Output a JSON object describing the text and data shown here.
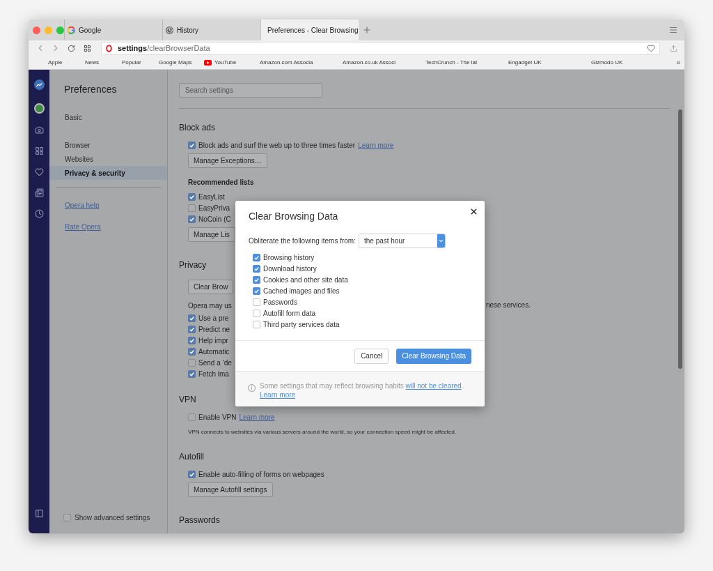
{
  "tabs": [
    {
      "title": "Google",
      "selected": false
    },
    {
      "title": "History",
      "selected": false
    },
    {
      "title": "Preferences - Clear Browsing",
      "selected": true
    }
  ],
  "address_bar": {
    "url": "**settings**/clearBrowserData"
  },
  "bookmarks": [
    {
      "label": "Apple",
      "kind": "plain"
    },
    {
      "label": "News",
      "kind": "plain"
    },
    {
      "label": "Popular",
      "kind": "plain"
    },
    {
      "label": "Google Maps",
      "kind": "plain"
    },
    {
      "label": "YouTube",
      "kind": "video"
    },
    {
      "label": "Amazon.com Associa",
      "kind": "plain"
    },
    {
      "label": "Amazon.co.uk Associ",
      "kind": "plain"
    },
    {
      "label": "TechCrunch - The lat",
      "kind": "plain"
    },
    {
      "label": "Engadget UK",
      "kind": "plain"
    },
    {
      "label": "Gizmodo UK",
      "kind": "plain"
    }
  ],
  "bookmarks_more": "»",
  "sidebar": {
    "title": "Preferences",
    "groups": [
      {
        "items": [
          {
            "label": "Basic",
            "selected": false
          }
        ]
      },
      {
        "items": [
          {
            "label": "Browser",
            "selected": false
          },
          {
            "label": "Websites",
            "selected": false
          },
          {
            "label": "Privacy & security",
            "selected": true
          }
        ]
      }
    ],
    "links": [
      "Opera help",
      "Rate Opera"
    ],
    "advanced": {
      "label": "Show advanced settings",
      "checked": false
    }
  },
  "search": {
    "placeholder": "Search settings"
  },
  "sections": [
    {
      "title": "Block ads",
      "blocks": [
        {
          "kind": "checkbox",
          "label": "Block ads and surf the web up to three times faster",
          "link": "Learn more",
          "checked": true
        },
        {
          "kind": "button",
          "label": "Manage Exceptions…"
        },
        {
          "kind": "subheading",
          "label": "Recommended lists"
        },
        {
          "kind": "checkbox",
          "label": "EasyList",
          "checked": true
        },
        {
          "kind": "checkbox",
          "label": "EasyPriva",
          "checked": false
        },
        {
          "kind": "checkbox",
          "label": "NoCoin (C",
          "checked": true
        },
        {
          "kind": "button",
          "label": "Manage Lis"
        }
      ]
    },
    {
      "title": "Privacy",
      "blocks": [
        {
          "kind": "button",
          "label": "Clear Brow"
        },
        {
          "kind": "split_note",
          "left": "Opera may us",
          "right": "nese services."
        },
        {
          "kind": "checkbox",
          "label": "Use a pre",
          "checked": true
        },
        {
          "kind": "checkbox",
          "label": "Predict ne",
          "checked": true
        },
        {
          "kind": "checkbox",
          "label": "Help impr",
          "checked": true
        },
        {
          "kind": "checkbox",
          "label": "Automatic",
          "checked": true
        },
        {
          "kind": "checkbox",
          "label": "Send a ‘de",
          "checked": false
        },
        {
          "kind": "checkbox",
          "label": "Fetch ima",
          "checked": true
        }
      ]
    },
    {
      "title": "VPN",
      "blocks": [
        {
          "kind": "checkbox",
          "label": "Enable VPN",
          "link": "Learn more",
          "checked": false
        },
        {
          "kind": "note",
          "label": "VPN connects to websites via various servers around the world, so your connection speed might be affected."
        }
      ]
    },
    {
      "title": "Autofill",
      "blocks": [
        {
          "kind": "checkbox",
          "label": "Enable auto-filling of forms on webpages",
          "checked": true
        },
        {
          "kind": "button",
          "label": "Manage Autofill settings"
        }
      ]
    },
    {
      "title": "Passwords"
    }
  ],
  "dialog": {
    "title": "Clear Browsing Data",
    "range_label": "Obliterate the following items from:",
    "range_value": "the past hour",
    "items": [
      {
        "label": "Browsing history",
        "checked": true
      },
      {
        "label": "Download history",
        "checked": true
      },
      {
        "label": "Cookies and other site data",
        "checked": true
      },
      {
        "label": "Cached images and files",
        "checked": true
      },
      {
        "label": "Passwords",
        "checked": false
      },
      {
        "label": "Autofill form data",
        "checked": false
      },
      {
        "label": "Third party services data",
        "checked": false
      }
    ],
    "buttons": [
      {
        "label": "Cancel",
        "kind": "secondary"
      },
      {
        "label": "Clear Browsing Data",
        "kind": "primary"
      }
    ],
    "info": {
      "text": "Some settings that may reflect browsing habits ",
      "link": "will not be cleared",
      "after": ".",
      "learn_more": "Learn more"
    }
  }
}
